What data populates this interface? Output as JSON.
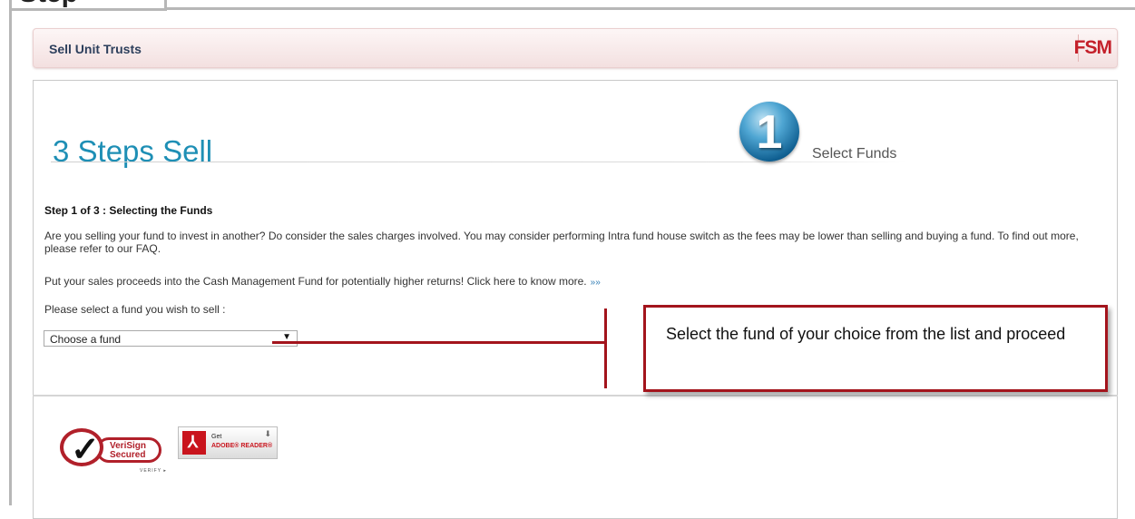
{
  "tab_fragment": "Step",
  "header": {
    "title": "Sell Unit Trusts",
    "logo": "FSM"
  },
  "wizard": {
    "title": "3 Steps Sell",
    "step_number": "1",
    "step_label": "Select Funds"
  },
  "content": {
    "heading": "Step 1 of 3 : Selecting the Funds",
    "paragraph1": "Are you selling your fund to invest in another? Do consider the sales charges involved. You may consider performing Intra fund house switch as the fees may be lower than selling and buying a fund. To find out more, please refer to our FAQ.",
    "paragraph2": "Put your sales proceeds into the Cash Management Fund for potentially higher returns! Click here to know more.",
    "more_link": "»»",
    "select_prompt": "Please select a fund you wish to sell :",
    "fund_select_value": "Choose a fund"
  },
  "callout": {
    "text": "Select the fund of your choice from the list and proceed"
  },
  "badges": {
    "verisign_line1": "VeriSign",
    "verisign_line2": "Secured",
    "verisign_verify": "VERIFY ▸",
    "adobe_get": "Get",
    "adobe_name": "ADOBE® READER®"
  },
  "colors": {
    "accent_red": "#a3141c",
    "title_blue": "#1e8fb5",
    "header_text": "#2d3f5c"
  }
}
